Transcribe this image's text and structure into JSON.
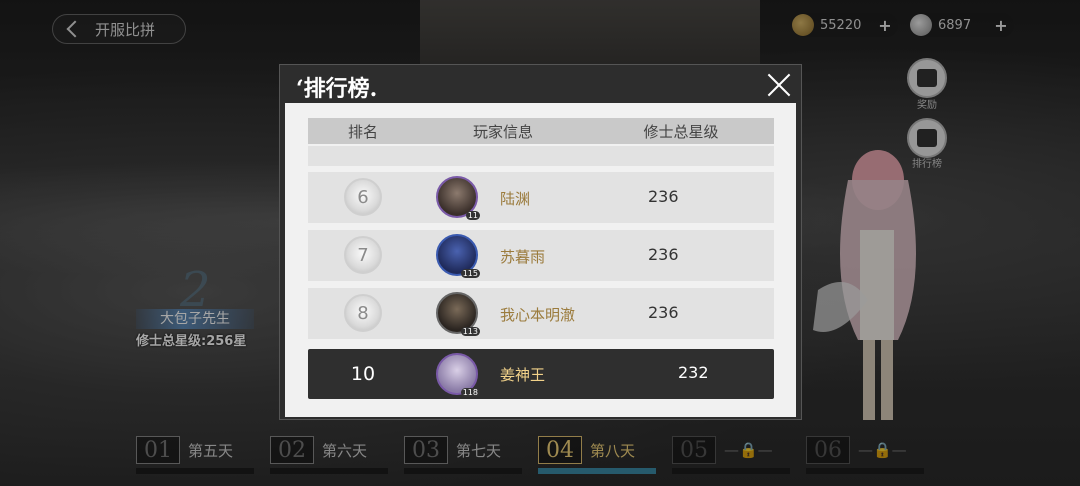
{
  "header": {
    "back_label": "开服比拼"
  },
  "currencies": [
    {
      "icon": "coin-icon",
      "value": "55220"
    },
    {
      "icon": "spirit-icon",
      "value": "6897"
    }
  ],
  "side_buttons": [
    {
      "icon": "reward-icon",
      "label": "奖励"
    },
    {
      "icon": "leaderboard-icon",
      "label": "排行榜"
    }
  ],
  "player": {
    "name": "大包子先生",
    "star_text": "修士总星级:256星"
  },
  "modal": {
    "title": "‘排行榜.",
    "columns": [
      "排名",
      "玩家信息",
      "修士总星级"
    ],
    "rows": [
      {
        "rank": "6",
        "name": "陆渊",
        "stars": "236",
        "level": "11"
      },
      {
        "rank": "7",
        "name": "苏暮雨",
        "stars": "236",
        "level": "115"
      },
      {
        "rank": "8",
        "name": "我心本明澈",
        "stars": "236",
        "level": "113"
      }
    ],
    "self": {
      "rank": "10",
      "name": "姜神王",
      "stars": "232",
      "level": "118"
    }
  },
  "days": [
    {
      "num": "01",
      "label": "第五天",
      "state": "normal"
    },
    {
      "num": "02",
      "label": "第六天",
      "state": "normal"
    },
    {
      "num": "03",
      "label": "第七天",
      "state": "normal"
    },
    {
      "num": "04",
      "label": "第八天",
      "state": "active"
    },
    {
      "num": "05",
      "label": "",
      "state": "locked"
    },
    {
      "num": "06",
      "label": "",
      "state": "locked"
    }
  ]
}
